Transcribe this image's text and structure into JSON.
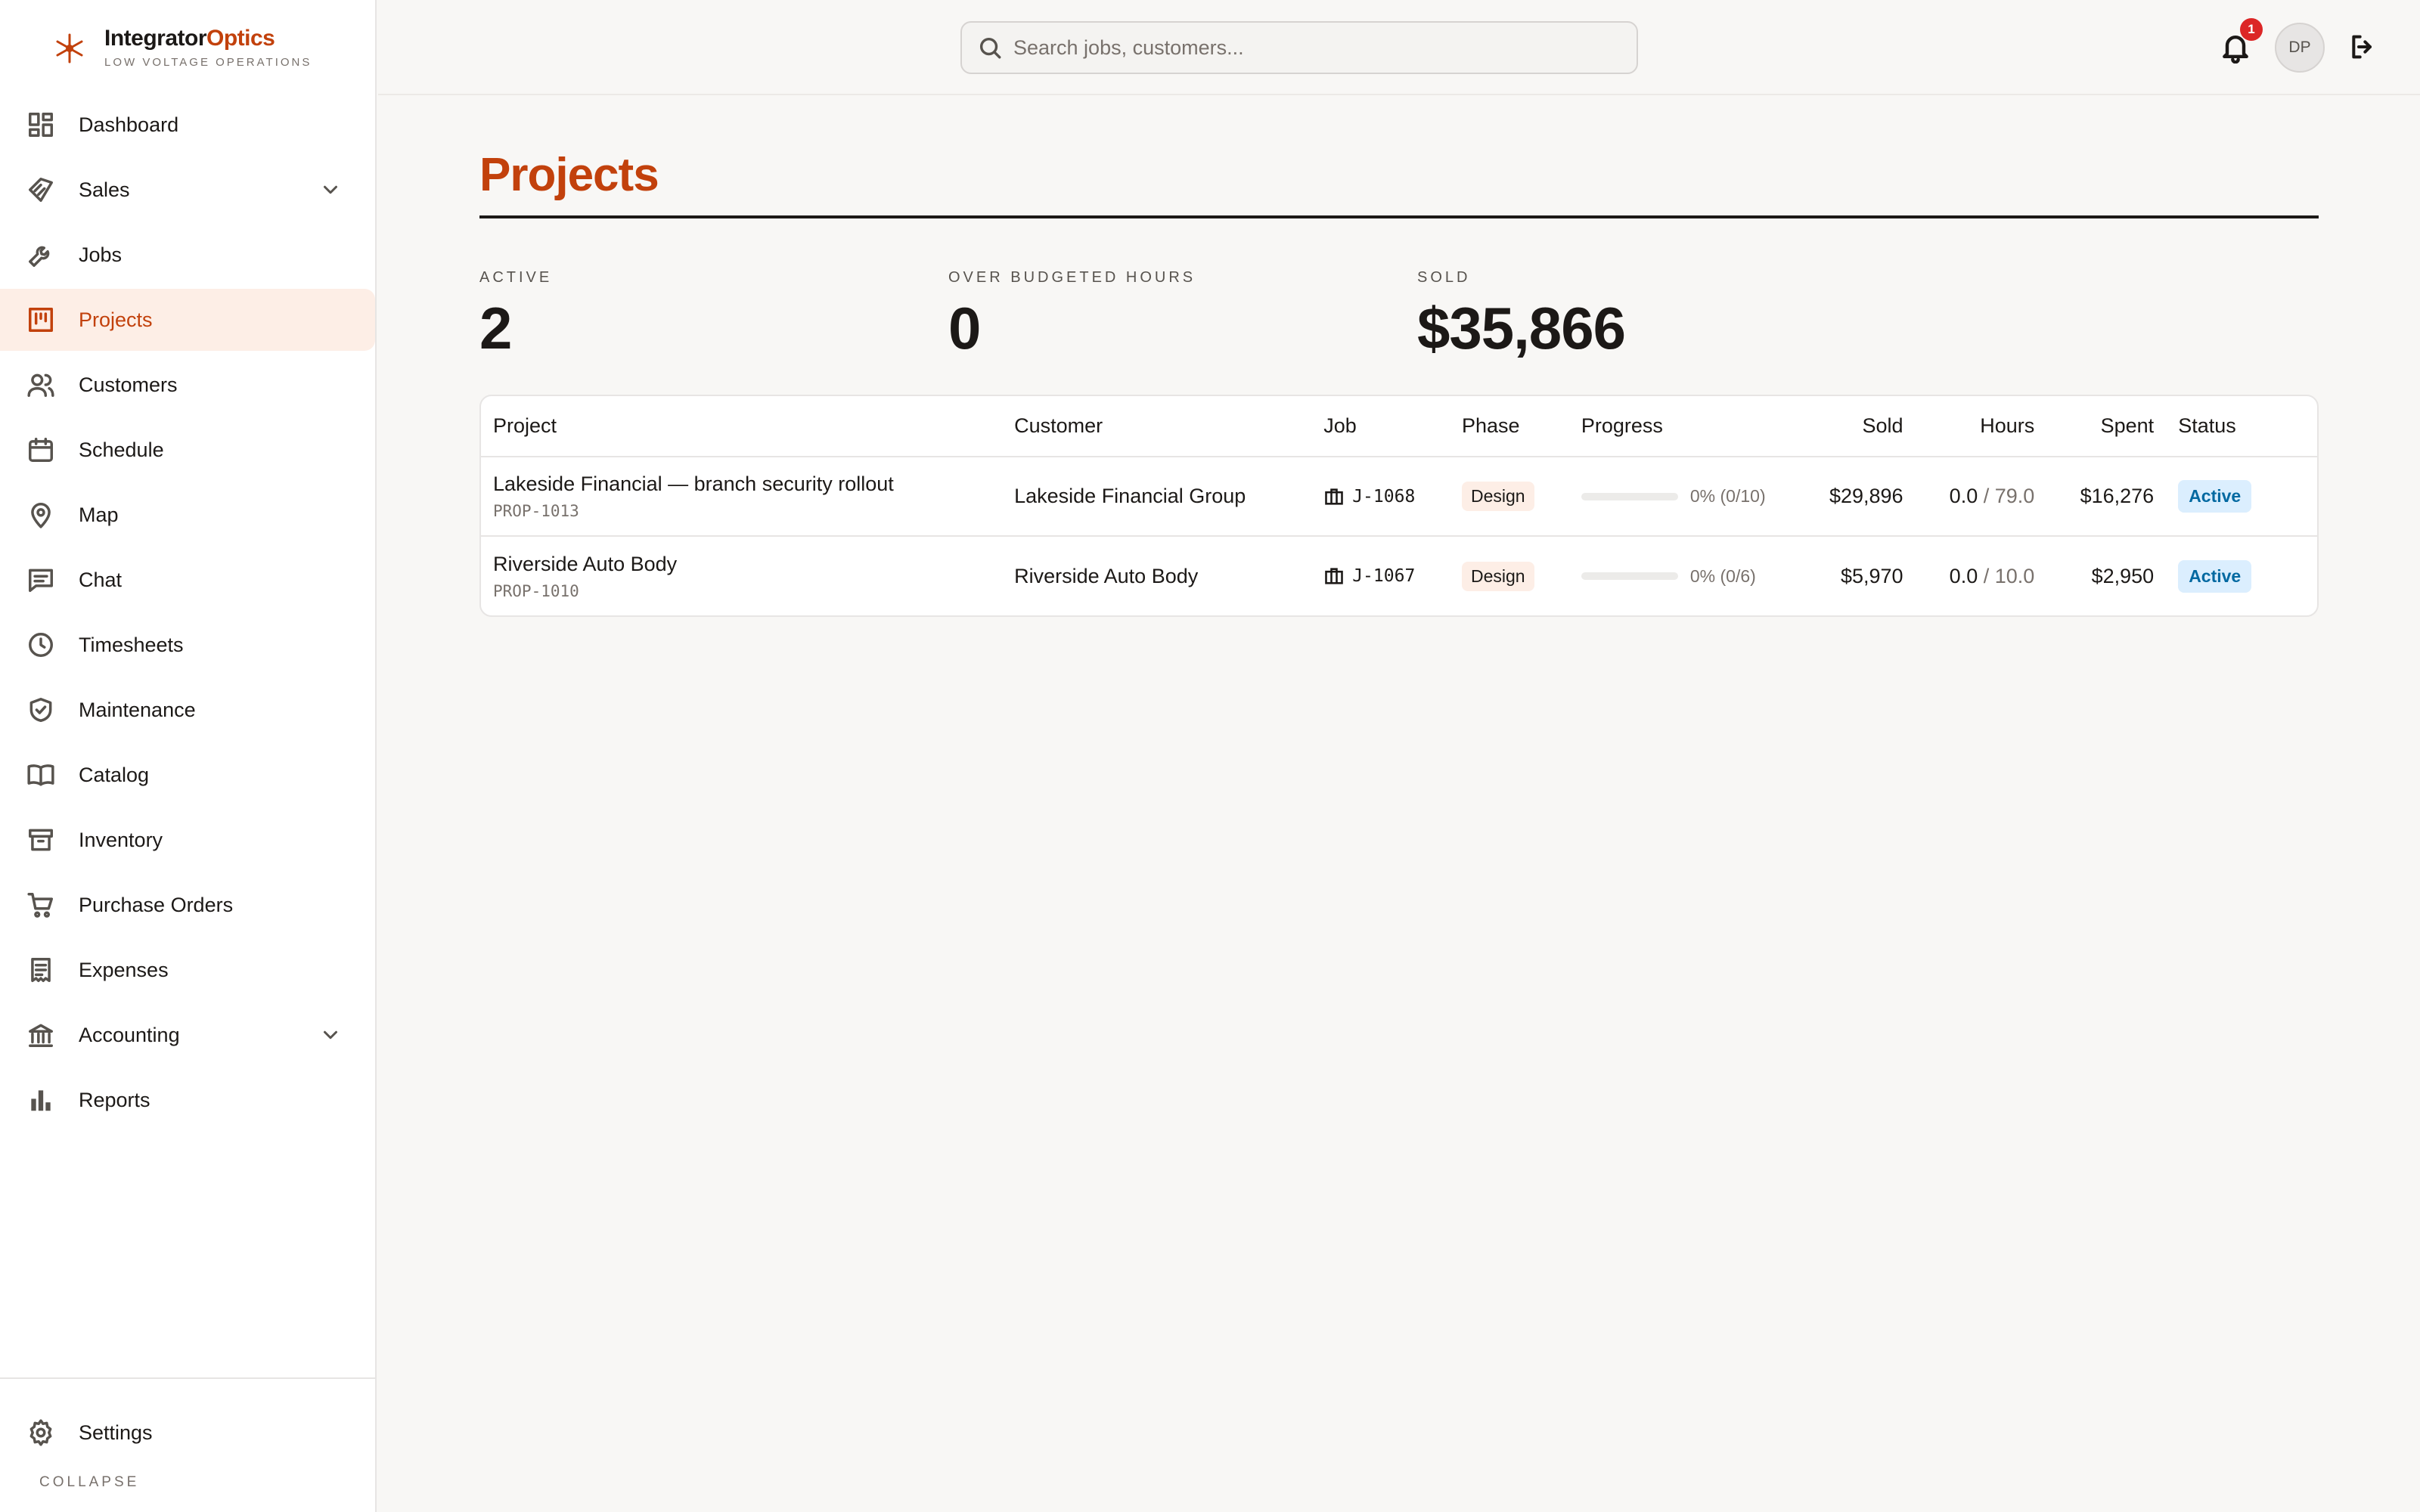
{
  "brand": {
    "name_part1": "Integrator",
    "name_part2": "Optics",
    "subtitle": "LOW VOLTAGE OPERATIONS",
    "accent_color": "#c2410c"
  },
  "sidebar": {
    "items": [
      {
        "label": "Dashboard",
        "icon": "dashboard-icon",
        "active": false
      },
      {
        "label": "Sales",
        "icon": "sales-tag-icon",
        "active": false,
        "expandable": true
      },
      {
        "label": "Jobs",
        "icon": "wrench-icon",
        "active": false
      },
      {
        "label": "Projects",
        "icon": "kanban-icon",
        "active": true
      },
      {
        "label": "Customers",
        "icon": "users-icon",
        "active": false
      },
      {
        "label": "Schedule",
        "icon": "calendar-icon",
        "active": false
      },
      {
        "label": "Map",
        "icon": "map-pin-icon",
        "active": false
      },
      {
        "label": "Chat",
        "icon": "chat-icon",
        "active": false
      },
      {
        "label": "Timesheets",
        "icon": "clock-icon",
        "active": false
      },
      {
        "label": "Maintenance",
        "icon": "shield-check-icon",
        "active": false
      },
      {
        "label": "Catalog",
        "icon": "book-icon",
        "active": false
      },
      {
        "label": "Inventory",
        "icon": "archive-box-icon",
        "active": false
      },
      {
        "label": "Purchase Orders",
        "icon": "cart-icon",
        "active": false
      },
      {
        "label": "Expenses",
        "icon": "receipt-icon",
        "active": false
      },
      {
        "label": "Accounting",
        "icon": "bank-icon",
        "active": false,
        "expandable": true
      },
      {
        "label": "Reports",
        "icon": "bar-chart-icon",
        "active": false
      }
    ],
    "settings_label": "Settings",
    "collapse_label": "COLLAPSE"
  },
  "topbar": {
    "search_placeholder": "Search jobs, customers...",
    "notification_count": "1",
    "avatar_initials": "DP"
  },
  "page": {
    "title": "Projects",
    "stats": [
      {
        "label": "ACTIVE",
        "value": "2"
      },
      {
        "label": "OVER BUDGETED HOURS",
        "value": "0"
      },
      {
        "label": "SOLD",
        "value": "$35,866"
      }
    ]
  },
  "table": {
    "columns": [
      "Project",
      "Customer",
      "Job",
      "Phase",
      "Progress",
      "Sold",
      "Hours",
      "Spent",
      "Status"
    ],
    "rows": [
      {
        "project": "Lakeside Financial — branch security rollout",
        "code": "PROP-1013",
        "customer": "Lakeside Financial Group",
        "job": "J-1068",
        "phase": "Design",
        "progress_fraction": 0,
        "progress_text": "0% (0/10)",
        "sold": "$29,896",
        "hours": "0.0",
        "hours_budget": "79.0",
        "spent": "$16,276",
        "status": "Active"
      },
      {
        "project": "Riverside Auto Body",
        "code": "PROP-1010",
        "customer": "Riverside Auto Body",
        "job": "J-1067",
        "phase": "Design",
        "progress_fraction": 0,
        "progress_text": "0% (0/6)",
        "sold": "$5,970",
        "hours": "0.0",
        "hours_budget": "10.0",
        "spent": "$2,950",
        "status": "Active"
      }
    ]
  }
}
